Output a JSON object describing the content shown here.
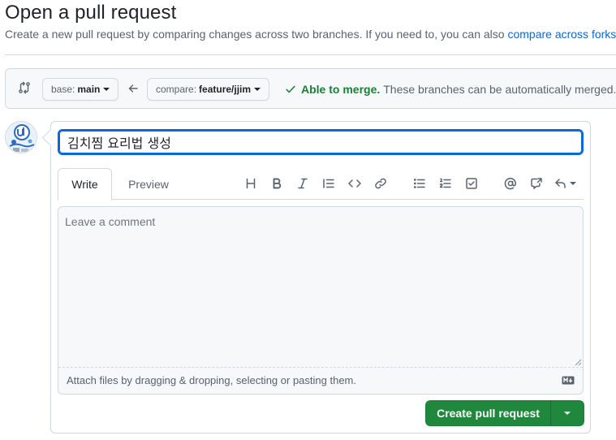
{
  "header": {
    "title": "Open a pull request",
    "subtitle": "Create a new pull request by comparing changes across two branches. If you need to, you can also ",
    "subtitle_link": "compare across forks",
    "subtitle_end": "."
  },
  "range": {
    "base_prefix": "base:",
    "base_branch": "main",
    "compare_prefix": "compare:",
    "compare_branch": "feature/jjim",
    "merge_ok": "Able to merge.",
    "merge_detail": "These branches can be automatically merged."
  },
  "composer": {
    "title_value": "김치찜 요리법 생성",
    "tabs": {
      "write": "Write",
      "preview": "Preview"
    },
    "body_placeholder": "Leave a comment",
    "attach_text": "Attach files by dragging & dropping, selecting or pasting them.",
    "submit_label": "Create pull request"
  },
  "colors": {
    "accent": "#0969da",
    "success": "#1a7f37",
    "primary_button": "#1f883d"
  }
}
